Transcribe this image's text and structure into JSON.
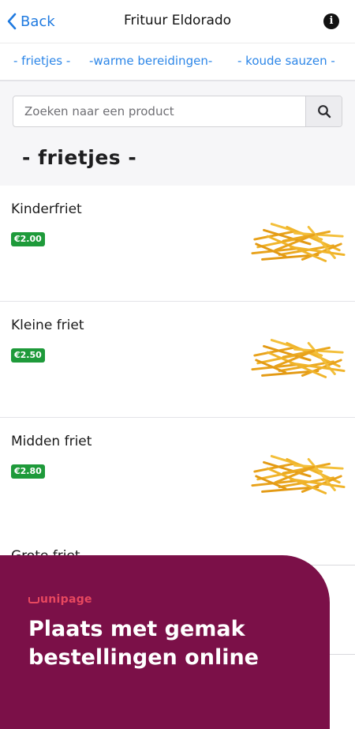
{
  "header": {
    "back_label": "Back",
    "title": "Frituur Eldorado",
    "info_icon": "info-icon"
  },
  "categories": [
    {
      "label": "- frietjes -"
    },
    {
      "label": "-warme bereidingen-"
    },
    {
      "label": "- koude sauzen -"
    }
  ],
  "search": {
    "placeholder": "Zoeken naar een product",
    "icon": "search-icon"
  },
  "section": {
    "heading": "- frietjes -"
  },
  "products": [
    {
      "name": "Kinderfriet",
      "price": "€2.00",
      "image": "fries-image"
    },
    {
      "name": "Kleine friet",
      "price": "€2.50",
      "image": "fries-image"
    },
    {
      "name": "Midden friet",
      "price": "€2.80",
      "image": "fries-image"
    },
    {
      "name": "Grote friet"
    }
  ],
  "promo": {
    "logo": "unipage",
    "headline": "Plaats met gemak bestellingen online",
    "background": "#7b1048",
    "accent": "#e8485f"
  },
  "colors": {
    "link": "#2c86e8",
    "price_badge": "#1e9a3a"
  }
}
